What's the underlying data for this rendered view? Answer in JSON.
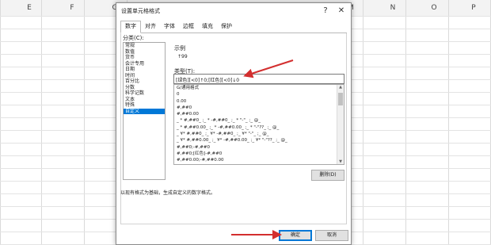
{
  "excel": {
    "columns": [
      "E",
      "F",
      "G",
      "M",
      "N",
      "O",
      "P"
    ]
  },
  "dialog": {
    "title": "设置单元格格式",
    "help_label": "?",
    "close_label": "✕",
    "tabs": [
      "数字",
      "对齐",
      "字体",
      "边框",
      "填充",
      "保护"
    ],
    "active_tab": "数字",
    "category_label": "分类(C):",
    "categories": [
      "常规",
      "数值",
      "货币",
      "会计专用",
      "日期",
      "时间",
      "百分比",
      "分数",
      "科学记数",
      "文本",
      "特殊",
      "自定义"
    ],
    "selected_category": "自定义",
    "sample_label": "示例",
    "sample_value": "↑99",
    "type_label": "类型(T):",
    "type_value": "[绿色][<0]↑0;[红色][<0]↓0",
    "format_list": [
      "G/通用格式",
      "0",
      "0.00",
      "#,##0",
      "#,##0.00",
      "_ * #,##0_ ;_ * -#,##0_ ;_ * \"-\"_ ;_ @_",
      "_ * #,##0.00_ ;_ * -#,##0.00_ ;_ * \"-\"??_ ;_ @_",
      "_ ¥* #,##0_ ;_ ¥* -#,##0_ ;_ ¥* \"-\"_ ;_ @_",
      "_ ¥* #,##0.00_ ;_ ¥* -#,##0.00_ ;_ ¥* \"-\"??_ ;_ @_",
      "#,##0;-#,##0",
      "#,##0;[红色]-#,##0",
      "#,##0.00;-#,##0.00"
    ],
    "delete_label": "删除(D)",
    "hint": "以现有格式为基础，生成自定义的数字格式。",
    "ok_label": "确定",
    "cancel_label": "取消"
  },
  "colors": {
    "selection": "#0078d7",
    "arrow": "#d32f2f"
  }
}
